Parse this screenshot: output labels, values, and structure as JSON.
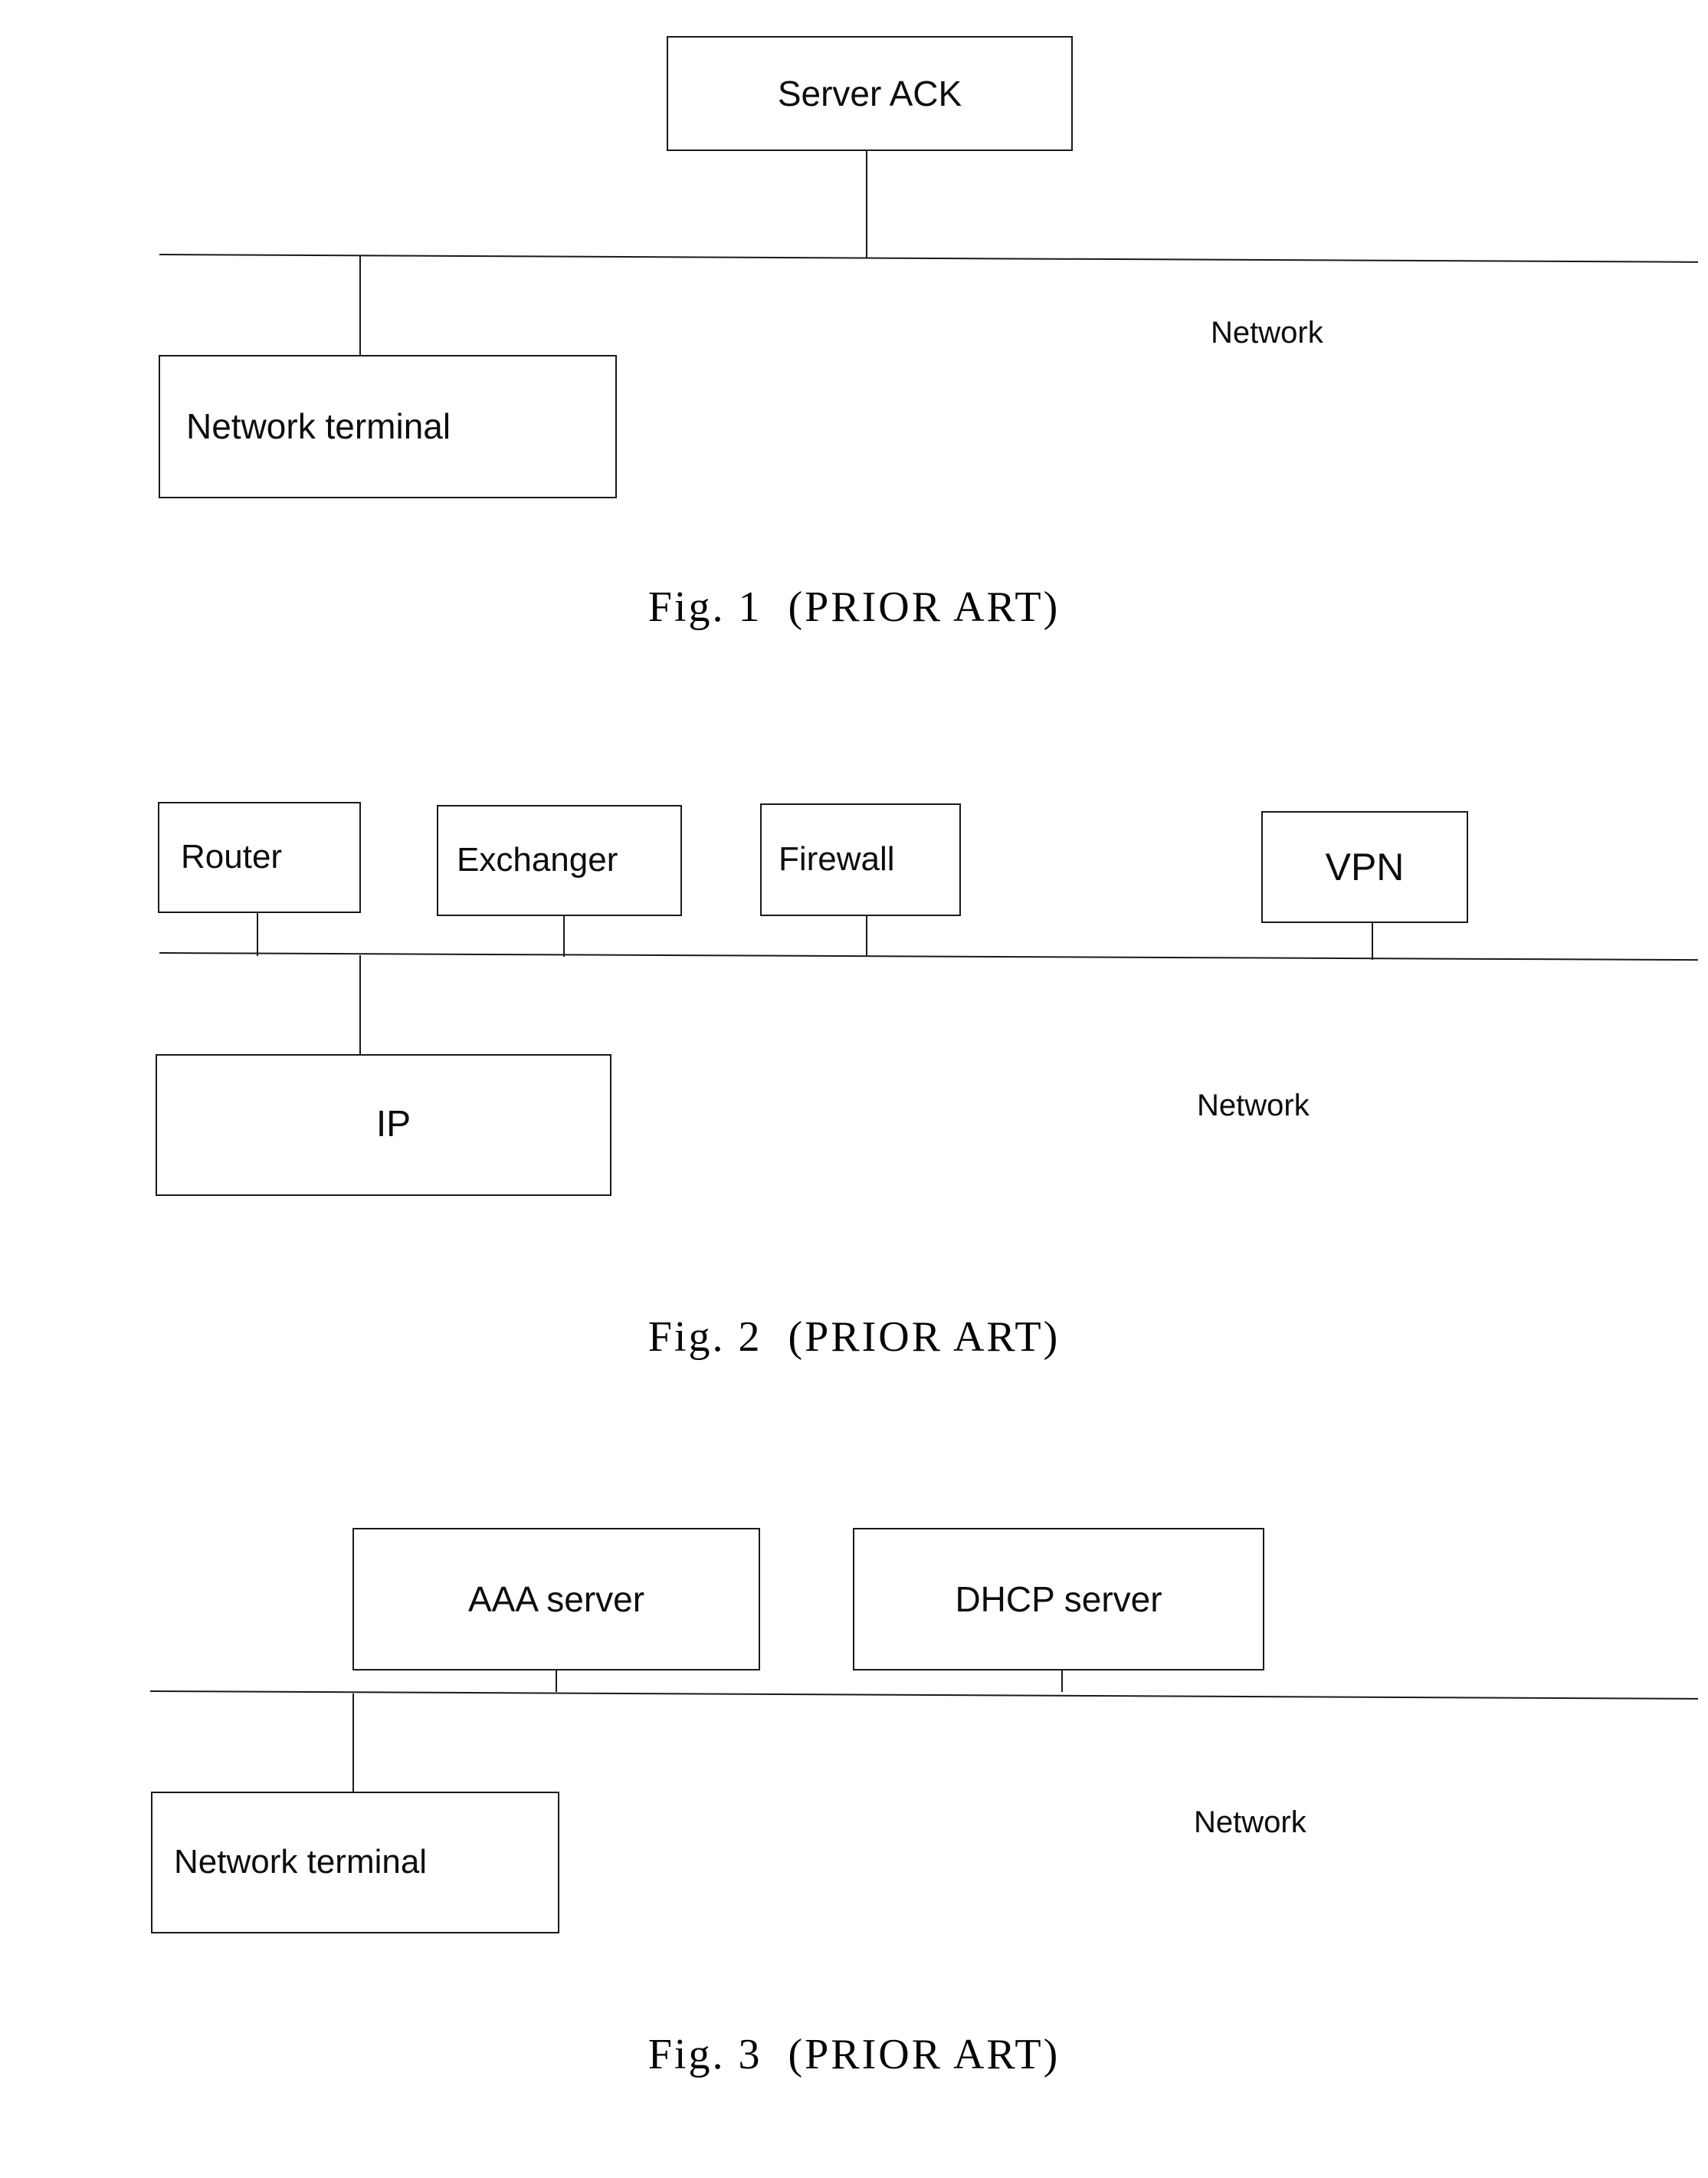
{
  "document": {
    "type": "patent-drawing-sheet",
    "figure_count": 3
  },
  "figures": [
    {
      "id": "fig1",
      "caption": "Fig. 1  (PRIOR ART)",
      "network_label": "Network",
      "nodes": [
        {
          "key": "server_ack",
          "label": "Server ACK"
        },
        {
          "key": "network_terminal",
          "label": "Network terminal"
        }
      ]
    },
    {
      "id": "fig2",
      "caption": "Fig. 2  (PRIOR ART)",
      "network_label": "Network",
      "nodes": [
        {
          "key": "router",
          "label": "Router"
        },
        {
          "key": "exchanger",
          "label": "Exchanger"
        },
        {
          "key": "firewall",
          "label": "Firewall"
        },
        {
          "key": "vpn",
          "label": "VPN"
        },
        {
          "key": "ip",
          "label": "IP"
        }
      ]
    },
    {
      "id": "fig3",
      "caption": "Fig. 3  (PRIOR ART)",
      "network_label": "Network",
      "nodes": [
        {
          "key": "aaa_server",
          "label": "AAA server"
        },
        {
          "key": "dhcp_server",
          "label": "DHCP server"
        },
        {
          "key": "network_terminal",
          "label": "Network terminal"
        }
      ]
    }
  ],
  "colors": {
    "ink": "#0d0d0d",
    "line": "#1a1a1a",
    "paper": "#ffffff"
  }
}
